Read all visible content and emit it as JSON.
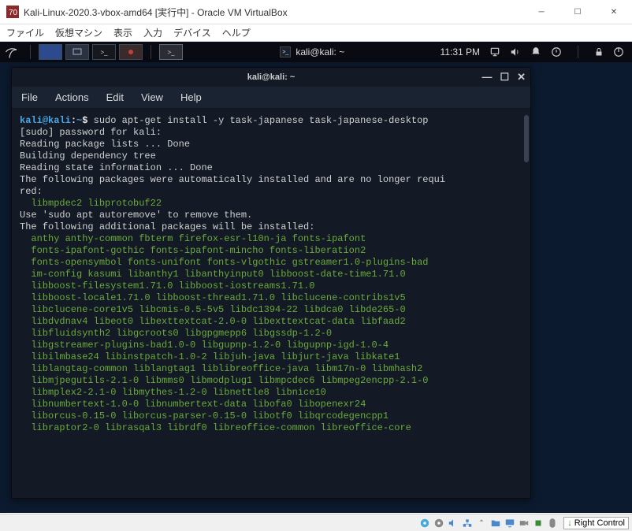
{
  "vbox": {
    "title": "Kali-Linux-2020.3-vbox-amd64 [実行中] - Oracle VM VirtualBox",
    "menu": [
      "ファイル",
      "仮想マシン",
      "表示",
      "入力",
      "デバイス",
      "ヘルプ"
    ],
    "host_key": "Right Control"
  },
  "panel": {
    "app_title": "kali@kali: ~",
    "clock": "11:31 PM"
  },
  "terminal": {
    "title": "kali@kali: ~",
    "menu": [
      "File",
      "Actions",
      "Edit",
      "View",
      "Help"
    ],
    "prompt": {
      "user": "kali",
      "at": "@",
      "host": "kali",
      "sep": ":",
      "path": "~",
      "sym": "$"
    },
    "command": "sudo apt-get install -y task-japanese task-japanese-desktop",
    "lines": [
      "[sudo] password for kali:",
      "Reading package lists ... Done",
      "Building dependency tree",
      "Reading state information ... Done",
      "The following packages were automatically installed and are no longer requi",
      "red:"
    ],
    "autoremove_pkgs": "  libmpdec2 libprotobuf22",
    "autoremove_hint": "Use 'sudo apt autoremove' to remove them.",
    "install_header": "The following additional packages will be installed:",
    "install_lines": [
      "  anthy anthy-common fbterm firefox-esr-l10n-ja fonts-ipafont",
      "  fonts-ipafont-gothic fonts-ipafont-mincho fonts-liberation2",
      "  fonts-opensymbol fonts-unifont fonts-vlgothic gstreamer1.0-plugins-bad",
      "  im-config kasumi libanthy1 libanthyinput0 libboost-date-time1.71.0",
      "  libboost-filesystem1.71.0 libboost-iostreams1.71.0",
      "  libboost-locale1.71.0 libboost-thread1.71.0 libclucene-contribs1v5",
      "  libclucene-core1v5 libcmis-0.5-5v5 libdc1394-22 libdca0 libde265-0",
      "  libdvdnav4 libeot0 libexttextcat-2.0-0 libexttextcat-data libfaad2",
      "  libfluidsynth2 libgcroots0 libgpgmepp6 libgssdp-1.2-0",
      "  libgstreamer-plugins-bad1.0-0 libgupnp-1.2-0 libgupnp-igd-1.0-4",
      "  libilmbase24 libinstpatch-1.0-2 libjuh-java libjurt-java libkate1",
      "  liblangtag-common liblangtag1 liblibreoffice-java libm17n-0 libmhash2",
      "  libmjpegutils-2.1-0 libmms0 libmodplug1 libmpcdec6 libmpeg2encpp-2.1-0",
      "  libmplex2-2.1-0 libmythes-1.2-0 libnettle8 libnice10",
      "  libnumbertext-1.0-0 libnumbertext-data libofa0 libopenexr24",
      "  liborcus-0.15-0 liborcus-parser-0.15-0 libotf0 libqrcodegencpp1",
      "  libraptor2-0 librasqal3 librdf0 libreoffice-common libreoffice-core"
    ]
  }
}
